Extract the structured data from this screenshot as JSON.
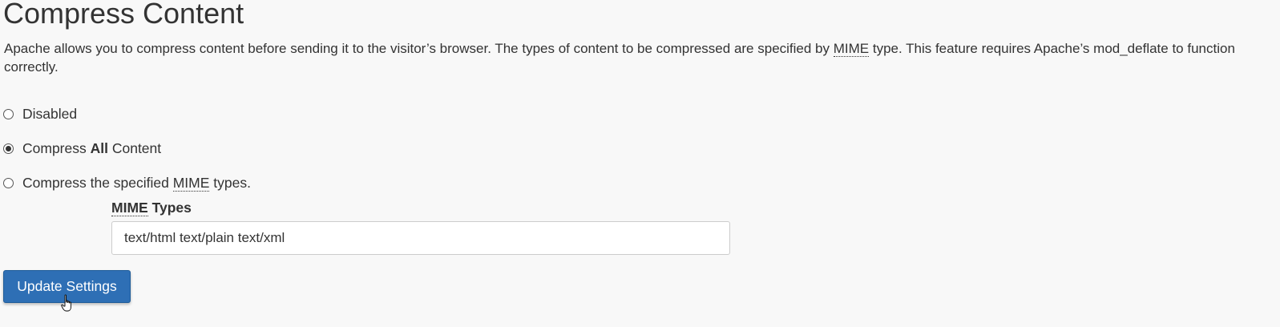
{
  "page": {
    "title": "Compress Content",
    "description": {
      "part1": "Apache allows you to compress content before sending it to the visitor’s browser. The types of content to be compressed are specified by ",
      "abbr": "MIME",
      "part2": " type. This feature requires Apache’s mod_deflate to function correctly."
    }
  },
  "options": {
    "disabled": {
      "label": "Disabled",
      "checked": false
    },
    "all": {
      "prefix": "Compress ",
      "emphasis": "All",
      "suffix": " Content",
      "checked": true
    },
    "mime": {
      "prefix": "Compress the specified ",
      "abbr": "MIME",
      "suffix": " types.",
      "checked": false
    }
  },
  "mime_types": {
    "label_abbr": "MIME",
    "label_suffix": " Types",
    "value": "text/html text/plain text/xml"
  },
  "actions": {
    "update_label": "Update Settings",
    "button_color": "#2e6fb5"
  },
  "cursor": {
    "icon": "hand-pointer-icon"
  }
}
